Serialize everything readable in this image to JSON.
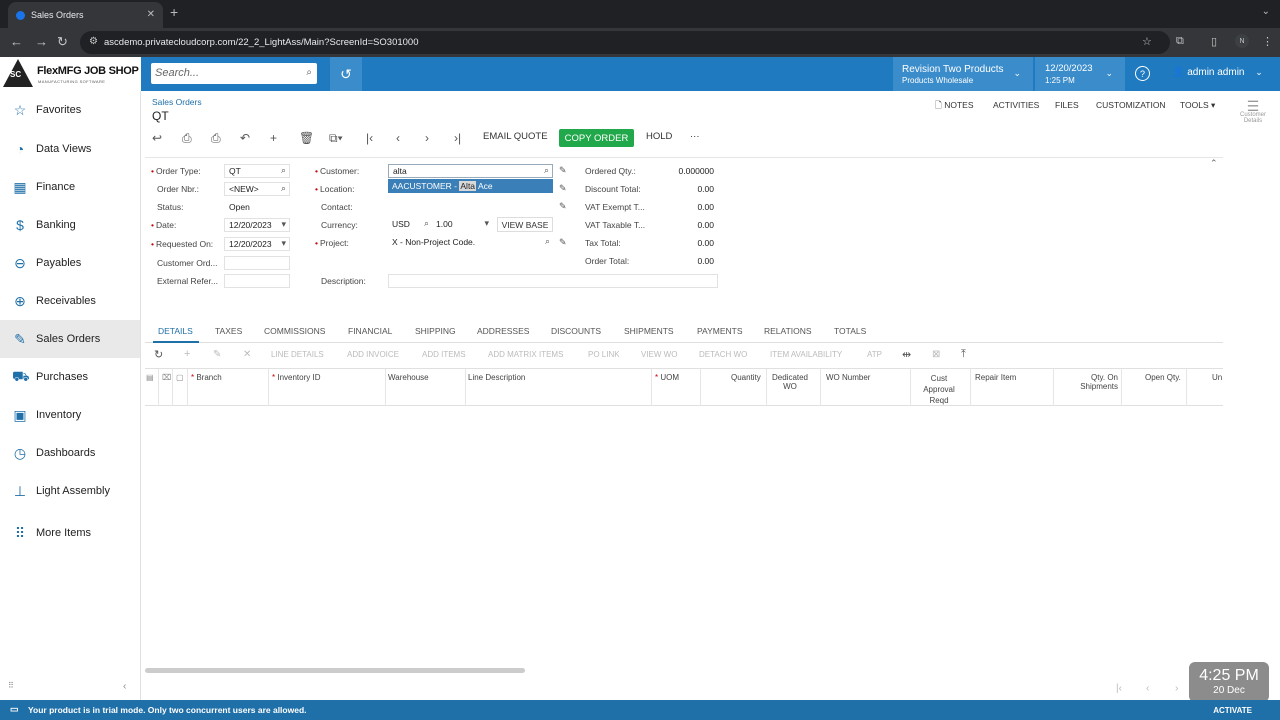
{
  "browser": {
    "tab_title": "Sales Orders",
    "url": "ascdemo.privatecloudcorp.com/22_2_LightAss/Main?ScreenId=SO301000",
    "profile_initial": "N"
  },
  "header": {
    "logo_name": "FlexMFG JOB SHOP",
    "logo_sub": "MANUFACTURING SOFTWARE",
    "logo_mark": "SC",
    "search_placeholder": "Search...",
    "branch_title": "Revision Two Products",
    "branch_sub": "Products Wholesale",
    "date": "12/20/2023",
    "time": "1:25 PM",
    "user": "admin admin"
  },
  "sidebar": {
    "items": [
      {
        "label": "Favorites",
        "icon": "star-icon"
      },
      {
        "label": "Data Views",
        "icon": "data-views-icon"
      },
      {
        "label": "Finance",
        "icon": "finance-icon"
      },
      {
        "label": "Banking",
        "icon": "dollar-icon"
      },
      {
        "label": "Payables",
        "icon": "minus-circle-icon"
      },
      {
        "label": "Receivables",
        "icon": "plus-circle-icon"
      },
      {
        "label": "Sales Orders",
        "icon": "pencil-square-icon"
      },
      {
        "label": "Purchases",
        "icon": "cart-icon"
      },
      {
        "label": "Inventory",
        "icon": "inventory-icon"
      },
      {
        "label": "Dashboards",
        "icon": "dashboard-icon"
      },
      {
        "label": "Light Assembly",
        "icon": "light-assembly-icon"
      },
      {
        "label": "More Items",
        "icon": "grid-icon"
      }
    ]
  },
  "page": {
    "breadcrumb": "Sales Orders",
    "title": "QT",
    "actions": {
      "notes": "NOTES",
      "activities": "ACTIVITIES",
      "files": "FILES",
      "customization": "CUSTOMIZATION",
      "tools": "TOOLS"
    },
    "right_panel": "Customer Details"
  },
  "toolbar": {
    "email_quote": "EMAIL QUOTE",
    "copy_order": "COPY ORDER",
    "hold": "HOLD",
    "more": "···"
  },
  "form": {
    "order_type": {
      "label": "Order Type:",
      "value": "QT"
    },
    "order_nbr": {
      "label": "Order Nbr.:",
      "value": "<NEW>"
    },
    "status": {
      "label": "Status:",
      "value": "Open"
    },
    "date": {
      "label": "Date:",
      "value": "12/20/2023"
    },
    "requested_on": {
      "label": "Requested On:",
      "value": "12/20/2023"
    },
    "customer_ord": {
      "label": "Customer Ord..."
    },
    "external_ref": {
      "label": "External Refer..."
    },
    "customer": {
      "label": "Customer:",
      "value": "alta"
    },
    "dropdown": {
      "prefix": "AACUSTOMER - ",
      "match": "Alta",
      "suffix": " Ace"
    },
    "location": {
      "label": "Location:"
    },
    "contact": {
      "label": "Contact:"
    },
    "currency": {
      "label": "Currency:",
      "value": "USD",
      "rate": "1.00",
      "view_base": "VIEW BASE"
    },
    "project": {
      "label": "Project:",
      "value": "X - Non-Project Code."
    },
    "description": {
      "label": "Description:"
    },
    "totals": [
      {
        "label": "Ordered Qty.:",
        "value": "0.000000"
      },
      {
        "label": "Discount Total:",
        "value": "0.00"
      },
      {
        "label": "VAT Exempt T...",
        "value": "0.00"
      },
      {
        "label": "VAT Taxable T...",
        "value": "0.00"
      },
      {
        "label": "Tax Total:",
        "value": "0.00"
      },
      {
        "label": "Order Total:",
        "value": "0.00"
      }
    ]
  },
  "tabs": [
    "DETAILS",
    "TAXES",
    "COMMISSIONS",
    "FINANCIAL",
    "SHIPPING",
    "ADDRESSES",
    "DISCOUNTS",
    "SHIPMENTS",
    "PAYMENTS",
    "RELATIONS",
    "TOTALS"
  ],
  "grid_toolbar": [
    "LINE DETAILS",
    "ADD INVOICE",
    "ADD ITEMS",
    "ADD MATRIX ITEMS",
    "PO LINK",
    "VIEW WO",
    "DETACH WO",
    "ITEM AVAILABILITY",
    "ATP"
  ],
  "grid_columns": {
    "branch": "Branch",
    "inventory_id": "Inventory ID",
    "warehouse": "Warehouse",
    "line_description": "Line Description",
    "uom": "UOM",
    "quantity": "Quantity",
    "dedicated_wo_1": "Dedicated",
    "dedicated_wo_2": "WO",
    "wo_number": "WO Number",
    "cust_1": "Cust",
    "cust_2": "Approval",
    "cust_3": "Reqd",
    "repair_item": "Repair Item",
    "qty_ship_1": "Qty. On",
    "qty_ship_2": "Shipments",
    "open_qty": "Open Qty.",
    "un": "Un"
  },
  "clock": {
    "time": "4:25 PM",
    "date": "20 Dec"
  },
  "status": {
    "message": "Your product is in trial mode. Only two concurrent users are allowed.",
    "activate": "ACTIVATE"
  }
}
